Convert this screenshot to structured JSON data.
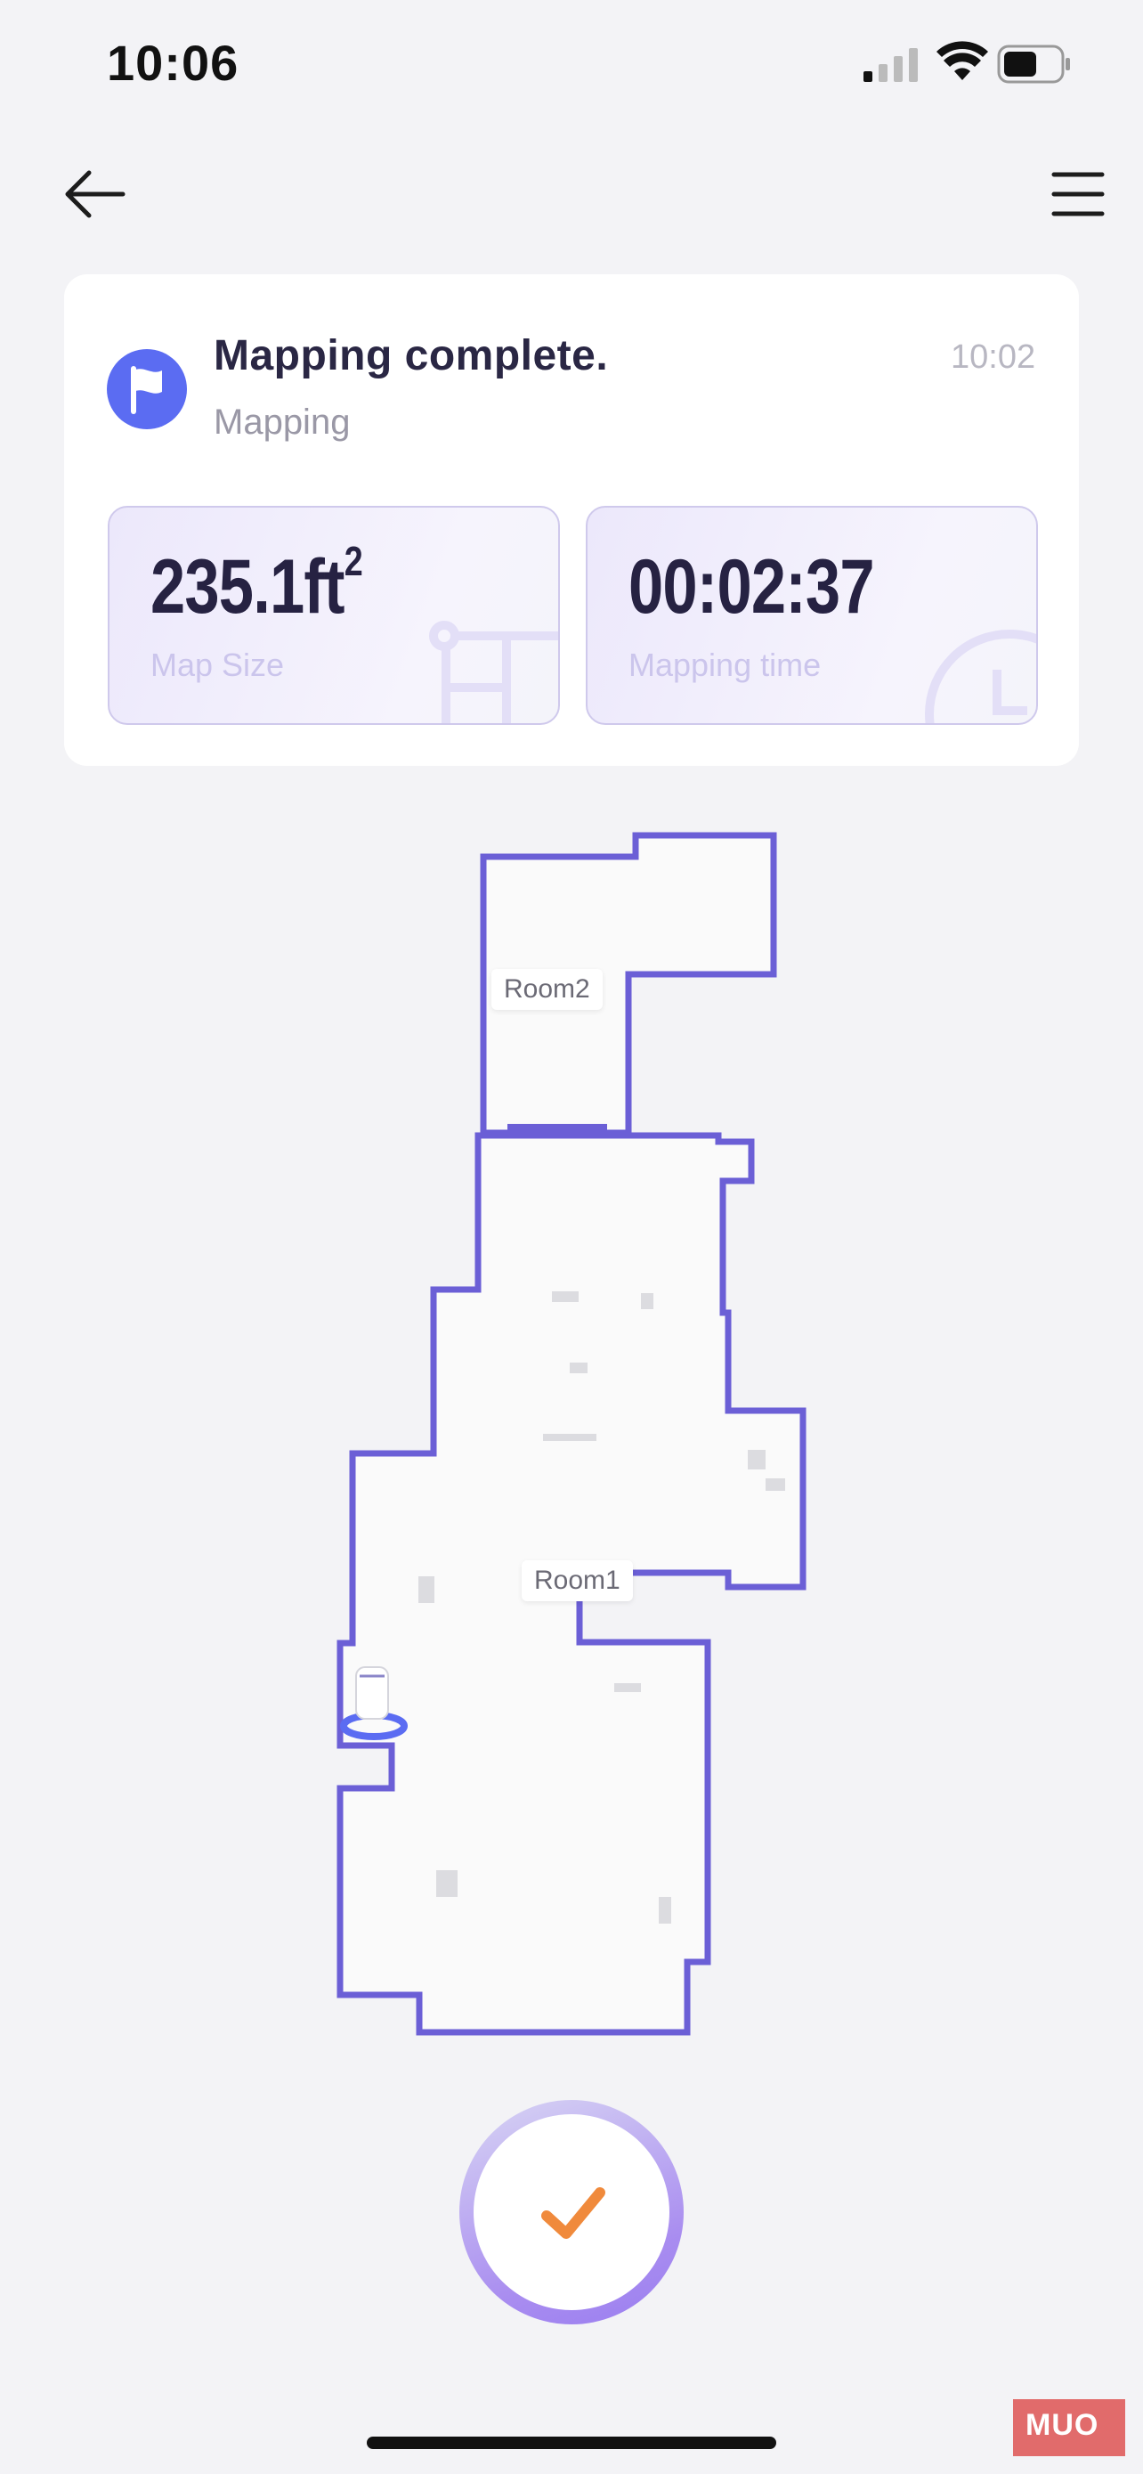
{
  "status_bar": {
    "time": "10:06"
  },
  "card": {
    "title": "Mapping complete.",
    "subtitle": "Mapping",
    "time": "10:02",
    "map_size": {
      "value": "235.1ft",
      "superscript": "2",
      "label": "Map Size"
    },
    "mapping_time": {
      "value": "00:02:37",
      "label": "Mapping time"
    }
  },
  "map": {
    "rooms": [
      {
        "label": "Room2"
      },
      {
        "label": "Room1"
      }
    ],
    "outline_color": "#6b5fd6"
  },
  "icons": {
    "back": "arrow-left-icon",
    "menu": "hamburger-menu-icon",
    "status": "flag-icon",
    "confirm": "checkmark-icon"
  },
  "watermark": "MUO",
  "colors": {
    "accent": "#5b6cf2",
    "check": "#f08a3c"
  }
}
